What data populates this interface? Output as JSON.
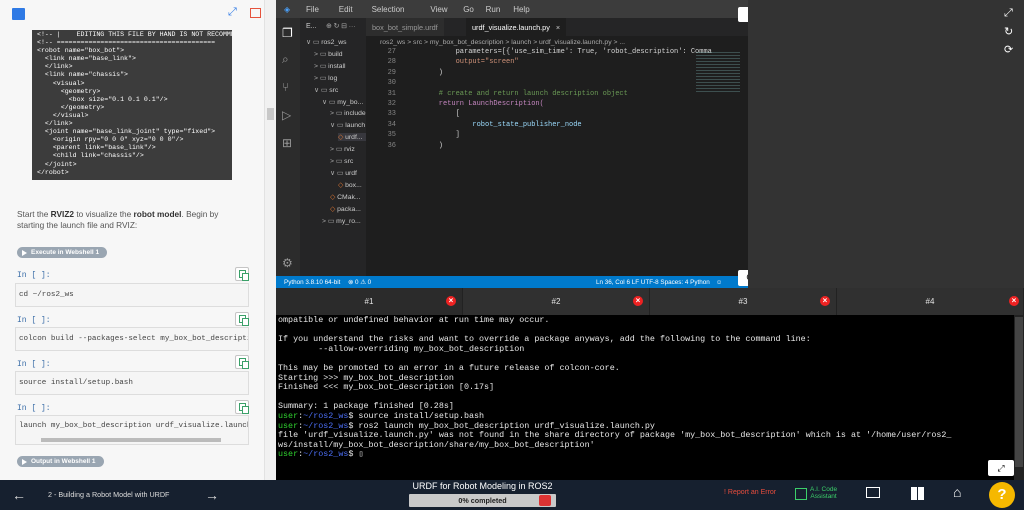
{
  "notebook": {
    "code_image_lines": [
      "<!-- |    EDITING THIS FILE BY HAND IS NOT RECOMMEN",
      "<!-- ========================================",
      "<robot name=\"box_bot\">",
      "  <link name=\"base_link\">",
      "  </link>",
      "  <link name=\"chassis\">",
      "    <visual>",
      "      <geometry>",
      "        <box size=\"0.1 0.1 0.1\"/>",
      "      </geometry>",
      "    </visual>",
      "  </link>",
      "  <joint name=\"base_link_joint\" type=\"fixed\">",
      "    <origin rpy=\"0 0 0\" xyz=\"0 0 0\"/>",
      "    <parent link=\"base_link\"/>",
      "    <child link=\"chassis\"/>",
      "  </joint>",
      "</robot>"
    ],
    "description_pre": "Start the ",
    "description_b1": "RVIZ2",
    "description_mid": " to visualize the ",
    "description_b2": "robot model",
    "description_post": ". Begin by starting the launch file and RVIZ:",
    "exec_button": "Execute in Webshell 1",
    "output_button": "Output in Webshell 1",
    "cells": [
      {
        "prompt": "In [ ]:",
        "code": "cd ~/ros2_ws"
      },
      {
        "prompt": "In [ ]:",
        "code": "colcon build --packages-select my_box_bot_description"
      },
      {
        "prompt": "In [ ]:",
        "code": "source install/setup.bash"
      },
      {
        "prompt": "In [ ]:",
        "code": "launch my_box_bot_description urdf_visualize.launch.py"
      }
    ]
  },
  "vscode": {
    "menu": [
      "File",
      "Edit",
      "Selection",
      "View",
      "Go",
      "Run",
      "Help"
    ],
    "explorer_label": "E...",
    "tabs": [
      "box_bot_simple.urdf",
      "urdf_visualize.launch.py"
    ],
    "tab_close": "×",
    "breadcrumb": "ros2_ws  >  src  >  my_box_bot_description  >  launch  >  urdf_visualize.launch.py  >  ...",
    "tree": [
      {
        "label": "ros2_ws",
        "indent": 0,
        "type": "folder-open"
      },
      {
        "label": "build",
        "indent": 1,
        "type": "folder"
      },
      {
        "label": "install",
        "indent": 1,
        "type": "folder"
      },
      {
        "label": "log",
        "indent": 1,
        "type": "folder"
      },
      {
        "label": "src",
        "indent": 1,
        "type": "folder-open"
      },
      {
        "label": "my_bo...",
        "indent": 2,
        "type": "folder-open"
      },
      {
        "label": "include",
        "indent": 3,
        "type": "folder"
      },
      {
        "label": "launch",
        "indent": 3,
        "type": "folder-open"
      },
      {
        "label": "urdf...",
        "indent": 4,
        "type": "file"
      },
      {
        "label": "rviz",
        "indent": 3,
        "type": "folder"
      },
      {
        "label": "src",
        "indent": 3,
        "type": "folder"
      },
      {
        "label": "urdf",
        "indent": 3,
        "type": "folder-open"
      },
      {
        "label": "box...",
        "indent": 4,
        "type": "file"
      },
      {
        "label": "CMak...",
        "indent": 3,
        "type": "file"
      },
      {
        "label": "packa...",
        "indent": 3,
        "type": "file"
      },
      {
        "label": "my_ro...",
        "indent": 2,
        "type": "folder"
      }
    ],
    "code_lines": [
      {
        "n": "27",
        "t": "        parameters=[{'use_sim_time': True, 'robot_description': Comma"
      },
      {
        "n": "28",
        "t": "        output=\"screen\""
      },
      {
        "n": "29",
        "t": "    )"
      },
      {
        "n": "30",
        "t": ""
      },
      {
        "n": "31",
        "t": "    # create and return launch description object"
      },
      {
        "n": "32",
        "t": "    return LaunchDescription("
      },
      {
        "n": "33",
        "t": "        ["
      },
      {
        "n": "34",
        "t": "            robot_state_publisher_node"
      },
      {
        "n": "35",
        "t": "        ]"
      },
      {
        "n": "36",
        "t": "    )"
      }
    ],
    "status_left": "Python 3.8.10 64-bit",
    "status_problems": "⊗ 0 ⚠ 0",
    "status_right": "Ln 36, Col 6   LF   UTF-8   Spaces: 4   Python"
  },
  "terminal": {
    "tabs": [
      "#1",
      "#2",
      "#3",
      "#4"
    ],
    "lines": [
      {
        "parts": [
          {
            "c": "",
            "t": "ompatible or undefined behavior at run time may occur."
          }
        ]
      },
      {
        "parts": [
          {
            "c": "",
            "t": ""
          }
        ]
      },
      {
        "parts": [
          {
            "c": "",
            "t": "If you understand the risks and want to override a package anyways, add the following to the command line:"
          }
        ]
      },
      {
        "parts": [
          {
            "c": "",
            "t": "        --allow-overriding my_box_bot_description"
          }
        ]
      },
      {
        "parts": [
          {
            "c": "",
            "t": ""
          }
        ]
      },
      {
        "parts": [
          {
            "c": "",
            "t": "This may be promoted to an error in a future release of colcon-core."
          }
        ]
      },
      {
        "parts": [
          {
            "c": "",
            "t": "Starting >>> my_box_bot_description"
          }
        ]
      },
      {
        "parts": [
          {
            "c": "",
            "t": "Finished <<< my_box_bot_description [0.17s]"
          }
        ]
      },
      {
        "parts": [
          {
            "c": "",
            "t": ""
          }
        ]
      },
      {
        "parts": [
          {
            "c": "",
            "t": "Summary: 1 package finished [0.28s]"
          }
        ]
      },
      {
        "parts": [
          {
            "c": "g",
            "t": "user"
          },
          {
            "c": "",
            "t": ":"
          },
          {
            "c": "b",
            "t": "~/ros2_ws"
          },
          {
            "c": "",
            "t": "$ source install/setup.bash"
          }
        ]
      },
      {
        "parts": [
          {
            "c": "g",
            "t": "user"
          },
          {
            "c": "",
            "t": ":"
          },
          {
            "c": "b",
            "t": "~/ros2_ws"
          },
          {
            "c": "",
            "t": "$ ros2 launch my_box_bot_description urdf_visualize.launch.py"
          }
        ]
      },
      {
        "parts": [
          {
            "c": "",
            "t": "file 'urdf_visualize.launch.py' was not found in the share directory of package 'my_box_bot_description' which is at '/home/user/ros2_"
          }
        ]
      },
      {
        "parts": [
          {
            "c": "",
            "t": "ws/install/my_box_bot_description/share/my_box_bot_description'"
          }
        ]
      },
      {
        "parts": [
          {
            "c": "g",
            "t": "user"
          },
          {
            "c": "",
            "t": ":"
          },
          {
            "c": "b",
            "t": "~/ros2_ws"
          },
          {
            "c": "",
            "t": "$ ▯"
          }
        ]
      }
    ]
  },
  "bottombar": {
    "lesson": "2 - Building a Robot Model with URDF",
    "course_title": "URDF for Robot Modeling in ROS2",
    "progress_label": "0% completed",
    "progress": 0,
    "report_error": "Report an Error",
    "ai_assistant_line1": "A.I. Code",
    "ai_assistant_line2": "Assistant",
    "help": "?"
  },
  "colors": {
    "accent": "#007acc",
    "bottom": "#16202f",
    "help": "#f5b800",
    "error": "#e22222"
  }
}
